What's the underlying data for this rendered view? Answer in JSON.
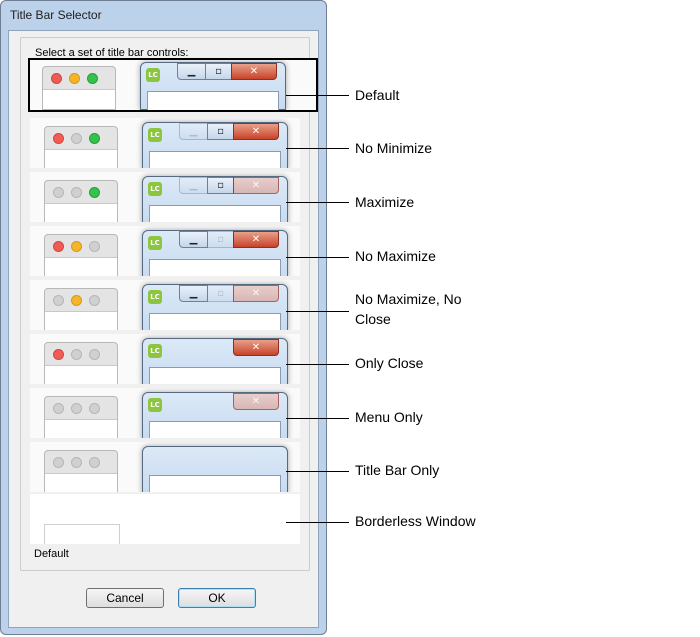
{
  "dialog": {
    "title": "Title Bar Selector",
    "group_label": "Select a set of title bar controls:",
    "selected_value": "Default",
    "cancel_label": "Cancel",
    "ok_label": "OK"
  },
  "options": [
    {
      "id": "default",
      "label": "Default",
      "mac": [
        "red",
        "yellow",
        "green"
      ],
      "win": {
        "icon": true,
        "min": "on",
        "max": "on",
        "close": "on"
      },
      "selected": true
    },
    {
      "id": "no-minimize",
      "label": "No Minimize",
      "mac": [
        "red",
        "grey",
        "green"
      ],
      "win": {
        "icon": true,
        "min": "off",
        "max": "on",
        "close": "on"
      }
    },
    {
      "id": "maximize",
      "label": "Maximize",
      "mac": [
        "grey",
        "grey",
        "green"
      ],
      "win": {
        "icon": true,
        "min": "off",
        "max": "on",
        "close": "off"
      }
    },
    {
      "id": "no-maximize",
      "label": "No Maximize",
      "mac": [
        "red",
        "yellow",
        "grey"
      ],
      "win": {
        "icon": true,
        "min": "on",
        "max": "off",
        "close": "on"
      }
    },
    {
      "id": "no-maximize-no-close",
      "label": "No Maximize, No Close",
      "mac": [
        "grey",
        "yellow",
        "grey"
      ],
      "win": {
        "icon": true,
        "min": "on",
        "max": "off",
        "close": "off"
      }
    },
    {
      "id": "only-close",
      "label": "Only Close",
      "mac": [
        "red",
        "grey",
        "grey"
      ],
      "win": {
        "icon": true,
        "min": "none",
        "max": "none",
        "close": "on"
      }
    },
    {
      "id": "menu-only",
      "label": "Menu Only",
      "mac": [
        "grey",
        "grey",
        "grey"
      ],
      "win": {
        "icon": true,
        "min": "none",
        "max": "none",
        "close": "off"
      }
    },
    {
      "id": "title-bar-only",
      "label": "Title Bar Only",
      "mac": [
        "grey",
        "grey",
        "grey"
      ],
      "win": {
        "icon": false,
        "min": "none",
        "max": "none",
        "close": "none"
      }
    },
    {
      "id": "borderless",
      "label": "Borderless Window",
      "borderless": true
    }
  ],
  "icons": {
    "app_icon": "livecode-icon",
    "minimize": "minimize-icon",
    "maximize": "maximize-icon",
    "close": "close-icon"
  },
  "app_icon_text": "LC",
  "glyphs": {
    "minimize": "▁",
    "maximize": "▫",
    "close": "✕"
  },
  "colors": {
    "mac_red": "#f15b55",
    "mac_yellow": "#f6b528",
    "mac_green": "#36c24a",
    "mac_grey": "#d0d0d0",
    "win_close": "#c8432a",
    "app_icon": "#8cc63f"
  }
}
